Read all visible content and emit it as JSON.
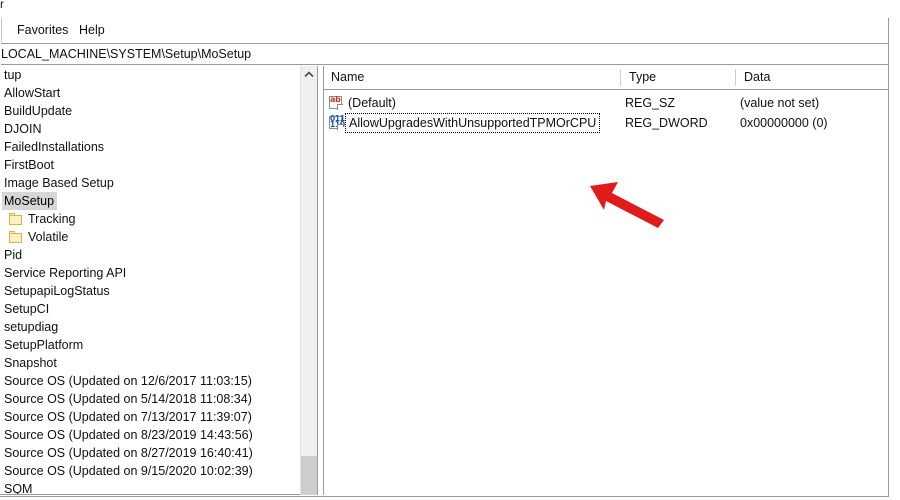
{
  "window": {
    "title_fragment": "r",
    "menu": [
      {
        "label": "Favorites",
        "x": 11
      },
      {
        "label": "Help",
        "x": 73
      }
    ],
    "address_path": "LOCAL_MACHINE\\SYSTEM\\Setup\\MoSetup"
  },
  "tree": {
    "items": [
      {
        "label": "tup",
        "depth": 0,
        "icon": "none",
        "selected": false
      },
      {
        "label": "AllowStart",
        "depth": 0,
        "icon": "none",
        "selected": false
      },
      {
        "label": "BuildUpdate",
        "depth": 0,
        "icon": "none",
        "selected": false
      },
      {
        "label": "DJOIN",
        "depth": 0,
        "icon": "none",
        "selected": false
      },
      {
        "label": "FailedInstallations",
        "depth": 0,
        "icon": "none",
        "selected": false
      },
      {
        "label": "FirstBoot",
        "depth": 0,
        "icon": "none",
        "selected": false
      },
      {
        "label": "Image Based Setup",
        "depth": 0,
        "icon": "none",
        "selected": false
      },
      {
        "label": "MoSetup",
        "depth": 0,
        "icon": "none",
        "selected": true
      },
      {
        "label": "Tracking",
        "depth": 1,
        "icon": "folder-icon",
        "selected": false
      },
      {
        "label": "Volatile",
        "depth": 1,
        "icon": "folder-icon",
        "selected": false
      },
      {
        "label": "Pid",
        "depth": 0,
        "icon": "none",
        "selected": false
      },
      {
        "label": "Service Reporting API",
        "depth": 0,
        "icon": "none",
        "selected": false
      },
      {
        "label": "SetupapiLogStatus",
        "depth": 0,
        "icon": "none",
        "selected": false
      },
      {
        "label": "SetupCI",
        "depth": 0,
        "icon": "none",
        "selected": false
      },
      {
        "label": "setupdiag",
        "depth": 0,
        "icon": "none",
        "selected": false
      },
      {
        "label": "SetupPlatform",
        "depth": 0,
        "icon": "none",
        "selected": false
      },
      {
        "label": "Snapshot",
        "depth": 0,
        "icon": "none",
        "selected": false
      },
      {
        "label": "Source OS (Updated on 12/6/2017 11:03:15)",
        "depth": 0,
        "icon": "none",
        "selected": false
      },
      {
        "label": "Source OS (Updated on 5/14/2018 11:08:34)",
        "depth": 0,
        "icon": "none",
        "selected": false
      },
      {
        "label": "Source OS (Updated on 7/13/2017 11:39:07)",
        "depth": 0,
        "icon": "none",
        "selected": false
      },
      {
        "label": "Source OS (Updated on 8/23/2019 14:43:56)",
        "depth": 0,
        "icon": "none",
        "selected": false
      },
      {
        "label": "Source OS (Updated on 8/27/2019 16:40:41)",
        "depth": 0,
        "icon": "none",
        "selected": false
      },
      {
        "label": "Source OS (Updated on 9/15/2020 10:02:39)",
        "depth": 0,
        "icon": "none",
        "selected": false
      },
      {
        "label": "SQM",
        "depth": 0,
        "icon": "none",
        "selected": false
      }
    ],
    "scrollbar": {
      "up_arrow_icon": "chevron-up-icon"
    }
  },
  "values": {
    "columns": [
      {
        "label": "Name"
      },
      {
        "label": "Type"
      },
      {
        "label": "Data"
      }
    ],
    "rows": [
      {
        "name": "(Default)",
        "type": "REG_SZ",
        "data": "(value not set)",
        "icon": "string-value-icon",
        "icon_glyph": "ab",
        "focused": false
      },
      {
        "name": "AllowUpgradesWithUnsupportedTPMOrCPU",
        "type": "REG_DWORD",
        "data": "0x00000000 (0)",
        "icon": "dword-value-icon",
        "icon_glyph_line1": "011",
        "icon_glyph_line2": "110",
        "focused": true
      }
    ]
  },
  "annotation": {
    "arrow_color": "#e01b1b",
    "points_to": "AllowUpgradesWithUnsupportedTPMOrCPU"
  }
}
